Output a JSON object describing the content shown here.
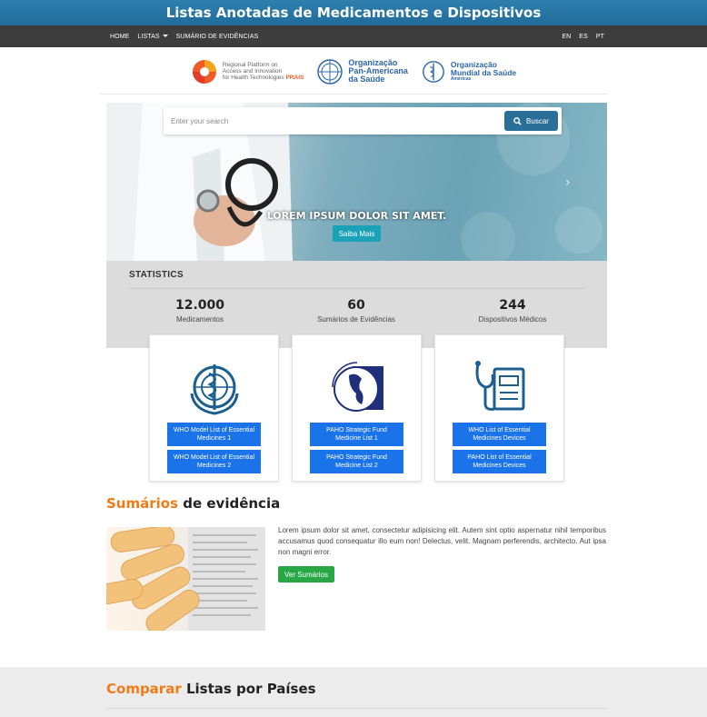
{
  "header": {
    "title": "Listas Anotadas de Medicamentos e Dispositivos"
  },
  "nav": {
    "home": "HOME",
    "listas": "LISTAS",
    "sumario": "SUMÁRIO DE EVIDÊNCIAS",
    "langs": [
      "EN",
      "ES",
      "PT"
    ]
  },
  "logos": {
    "prais_line1": "Regional Platform on",
    "prais_line2": "Access and Innovation",
    "prais_line3": "for Health Technologies",
    "prais_tag": "PRAIS",
    "paho_line1": "Organização",
    "paho_line2": "Pan-Americana",
    "paho_line3": "da Saúde",
    "who_line1": "Organização",
    "who_line2": "Mundial da Saúde",
    "who_line3": "Américas"
  },
  "search": {
    "placeholder": "Enter your search",
    "button": "Buscar"
  },
  "hero": {
    "caption": "LOREM IPSUM DOLOR SIT AMET.",
    "button": "Saiba Mais"
  },
  "stats": {
    "title": "STATISTICS",
    "items": [
      {
        "value": "12.000",
        "label": "Medicamentos"
      },
      {
        "value": "60",
        "label": "Sumários de Evidências"
      },
      {
        "value": "244",
        "label": "Dispositivos Médicos"
      }
    ]
  },
  "cards": [
    {
      "b1": "WHO Model List of Essential Medicines 1",
      "b2": "WHO Model List of Essential Medicines 2"
    },
    {
      "b1": "PAHO Strategic Fund Medicine List 1",
      "b2": "PAHO Strategic Fund Medicine List 2"
    },
    {
      "b1": "WHO List of Essential Medicines Devices",
      "b2": "PAHO List of Essential Medicines Devices"
    }
  ],
  "sumarios": {
    "title_hl": "Sumários",
    "title_rest": " de evidência",
    "text": "Lorem ipsum dolor sit amet, consectetur adipisicing elit. Autem sint optio aspernatur nihil temporibus accusamus quod consequatur illo eum non! Delectus, velit. Magnam perferendis, architecto. Aut ipsa non magni error.",
    "button": "Ver Sumários"
  },
  "comparar": {
    "title_hl": "Comparar",
    "title_rest": " Listas por Países"
  },
  "colors": {
    "header": "#2a78a8",
    "navbar": "#3d3d3d",
    "accent_orange": "#f07c17",
    "button_blue": "#1a73e8",
    "button_green": "#28a745",
    "teal": "#1ca2b8"
  }
}
